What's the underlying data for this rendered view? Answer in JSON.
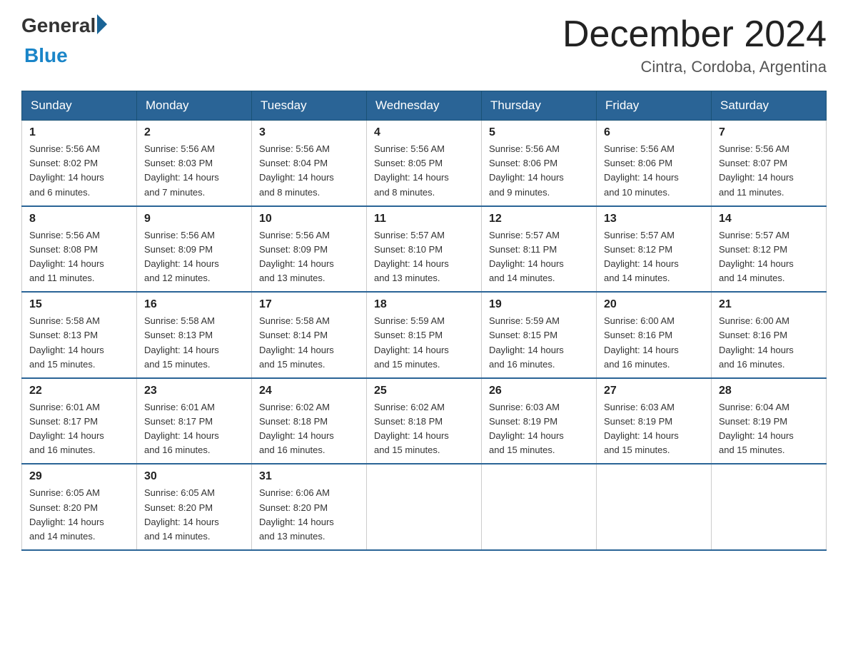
{
  "header": {
    "logo_general": "General",
    "logo_blue": "Blue",
    "month_title": "December 2024",
    "location": "Cintra, Cordoba, Argentina"
  },
  "days_of_week": [
    "Sunday",
    "Monday",
    "Tuesday",
    "Wednesday",
    "Thursday",
    "Friday",
    "Saturday"
  ],
  "weeks": [
    [
      {
        "day": "1",
        "sunrise": "5:56 AM",
        "sunset": "8:02 PM",
        "daylight": "14 hours and 6 minutes."
      },
      {
        "day": "2",
        "sunrise": "5:56 AM",
        "sunset": "8:03 PM",
        "daylight": "14 hours and 7 minutes."
      },
      {
        "day": "3",
        "sunrise": "5:56 AM",
        "sunset": "8:04 PM",
        "daylight": "14 hours and 8 minutes."
      },
      {
        "day": "4",
        "sunrise": "5:56 AM",
        "sunset": "8:05 PM",
        "daylight": "14 hours and 8 minutes."
      },
      {
        "day": "5",
        "sunrise": "5:56 AM",
        "sunset": "8:06 PM",
        "daylight": "14 hours and 9 minutes."
      },
      {
        "day": "6",
        "sunrise": "5:56 AM",
        "sunset": "8:06 PM",
        "daylight": "14 hours and 10 minutes."
      },
      {
        "day": "7",
        "sunrise": "5:56 AM",
        "sunset": "8:07 PM",
        "daylight": "14 hours and 11 minutes."
      }
    ],
    [
      {
        "day": "8",
        "sunrise": "5:56 AM",
        "sunset": "8:08 PM",
        "daylight": "14 hours and 11 minutes."
      },
      {
        "day": "9",
        "sunrise": "5:56 AM",
        "sunset": "8:09 PM",
        "daylight": "14 hours and 12 minutes."
      },
      {
        "day": "10",
        "sunrise": "5:56 AM",
        "sunset": "8:09 PM",
        "daylight": "14 hours and 13 minutes."
      },
      {
        "day": "11",
        "sunrise": "5:57 AM",
        "sunset": "8:10 PM",
        "daylight": "14 hours and 13 minutes."
      },
      {
        "day": "12",
        "sunrise": "5:57 AM",
        "sunset": "8:11 PM",
        "daylight": "14 hours and 14 minutes."
      },
      {
        "day": "13",
        "sunrise": "5:57 AM",
        "sunset": "8:12 PM",
        "daylight": "14 hours and 14 minutes."
      },
      {
        "day": "14",
        "sunrise": "5:57 AM",
        "sunset": "8:12 PM",
        "daylight": "14 hours and 14 minutes."
      }
    ],
    [
      {
        "day": "15",
        "sunrise": "5:58 AM",
        "sunset": "8:13 PM",
        "daylight": "14 hours and 15 minutes."
      },
      {
        "day": "16",
        "sunrise": "5:58 AM",
        "sunset": "8:13 PM",
        "daylight": "14 hours and 15 minutes."
      },
      {
        "day": "17",
        "sunrise": "5:58 AM",
        "sunset": "8:14 PM",
        "daylight": "14 hours and 15 minutes."
      },
      {
        "day": "18",
        "sunrise": "5:59 AM",
        "sunset": "8:15 PM",
        "daylight": "14 hours and 15 minutes."
      },
      {
        "day": "19",
        "sunrise": "5:59 AM",
        "sunset": "8:15 PM",
        "daylight": "14 hours and 16 minutes."
      },
      {
        "day": "20",
        "sunrise": "6:00 AM",
        "sunset": "8:16 PM",
        "daylight": "14 hours and 16 minutes."
      },
      {
        "day": "21",
        "sunrise": "6:00 AM",
        "sunset": "8:16 PM",
        "daylight": "14 hours and 16 minutes."
      }
    ],
    [
      {
        "day": "22",
        "sunrise": "6:01 AM",
        "sunset": "8:17 PM",
        "daylight": "14 hours and 16 minutes."
      },
      {
        "day": "23",
        "sunrise": "6:01 AM",
        "sunset": "8:17 PM",
        "daylight": "14 hours and 16 minutes."
      },
      {
        "day": "24",
        "sunrise": "6:02 AM",
        "sunset": "8:18 PM",
        "daylight": "14 hours and 16 minutes."
      },
      {
        "day": "25",
        "sunrise": "6:02 AM",
        "sunset": "8:18 PM",
        "daylight": "14 hours and 15 minutes."
      },
      {
        "day": "26",
        "sunrise": "6:03 AM",
        "sunset": "8:19 PM",
        "daylight": "14 hours and 15 minutes."
      },
      {
        "day": "27",
        "sunrise": "6:03 AM",
        "sunset": "8:19 PM",
        "daylight": "14 hours and 15 minutes."
      },
      {
        "day": "28",
        "sunrise": "6:04 AM",
        "sunset": "8:19 PM",
        "daylight": "14 hours and 15 minutes."
      }
    ],
    [
      {
        "day": "29",
        "sunrise": "6:05 AM",
        "sunset": "8:20 PM",
        "daylight": "14 hours and 14 minutes."
      },
      {
        "day": "30",
        "sunrise": "6:05 AM",
        "sunset": "8:20 PM",
        "daylight": "14 hours and 14 minutes."
      },
      {
        "day": "31",
        "sunrise": "6:06 AM",
        "sunset": "8:20 PM",
        "daylight": "14 hours and 13 minutes."
      },
      null,
      null,
      null,
      null
    ]
  ],
  "labels": {
    "sunrise": "Sunrise:",
    "sunset": "Sunset:",
    "daylight": "Daylight:"
  }
}
